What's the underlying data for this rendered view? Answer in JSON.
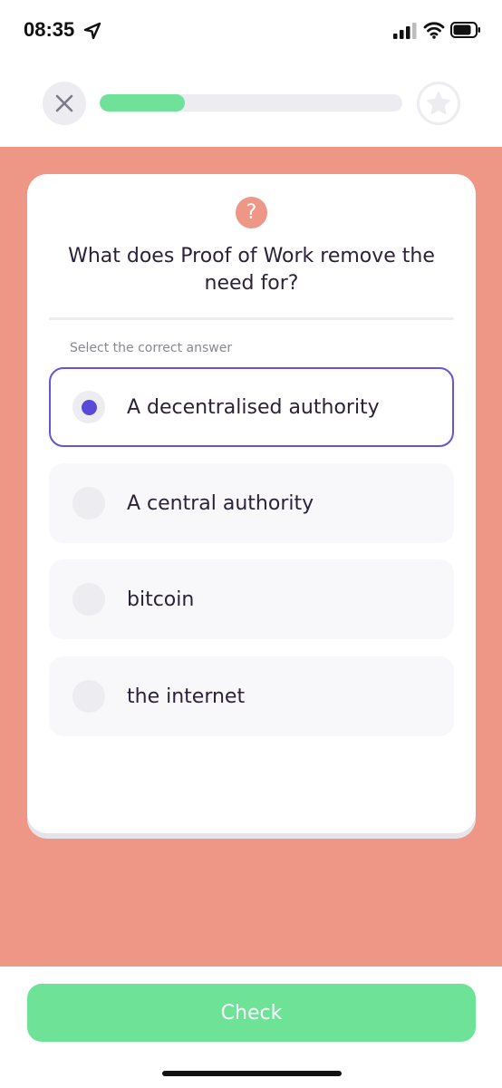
{
  "status_bar": {
    "time": "08:35",
    "icons": [
      "location-arrow-icon",
      "signal-icon",
      "wifi-icon",
      "battery-icon"
    ]
  },
  "nav": {
    "close_icon": "close-icon",
    "progress": 0.28,
    "progress_color": "#6fe199",
    "star_icon": "star-icon"
  },
  "quiz": {
    "help_icon": "question-mark-icon",
    "help_symbol": "?",
    "question": "What does Proof of Work remove the need for?",
    "instruction": "Select the correct answer",
    "options": [
      {
        "label": "A decentralised authority",
        "selected": true
      },
      {
        "label": "A central authority",
        "selected": false
      },
      {
        "label": "bitcoin",
        "selected": false
      },
      {
        "label": "the internet",
        "selected": false
      }
    ]
  },
  "footer": {
    "check_label": "Check"
  },
  "colors": {
    "background": "#ef9787",
    "accent": "#6853d3",
    "button": "#6ee398"
  }
}
